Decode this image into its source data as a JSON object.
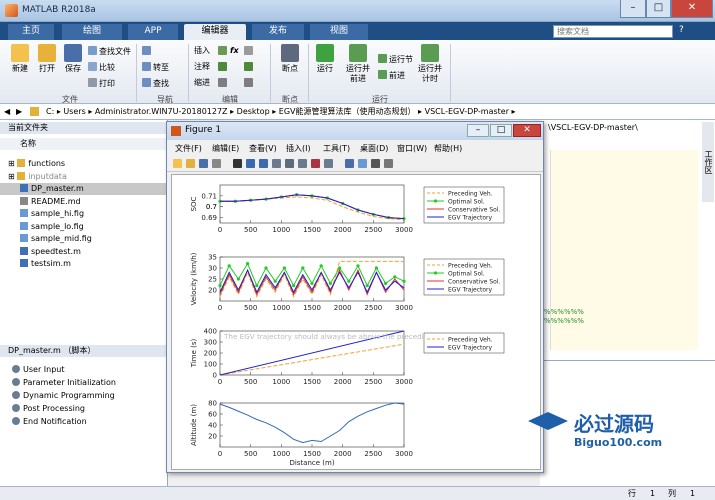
{
  "window": {
    "title": "MATLAB R2018a",
    "min": "–",
    "max": "□",
    "close": "✕"
  },
  "tabs": [
    {
      "label": "主页"
    },
    {
      "label": "绘图"
    },
    {
      "label": "APP"
    },
    {
      "label": "编辑器"
    },
    {
      "label": "发布"
    },
    {
      "label": "视图"
    }
  ],
  "search_placeholder": "搜索文档",
  "ribbon": {
    "new": "新建",
    "open": "打开",
    "save": "保存",
    "find_file": "查找文件",
    "compare": "比较",
    "print": "打印",
    "group_file": "文件",
    "goto": "转至",
    "find": "查找",
    "group_nav": "导航",
    "insert": "插入",
    "comment": "注释",
    "indent": "缩进",
    "group_edit": "编辑",
    "breakpoint": "断点",
    "group_bp": "断点",
    "run": "运行",
    "run_advance": "运行并\n前进",
    "run_section": "运行节",
    "advance": "前进",
    "run_time": "运行并\n计时",
    "group_run": "运行",
    "fx": "fx"
  },
  "addr": {
    "path": [
      "C:",
      "Users",
      "Administrator.WIN7U-20180127Z",
      "Desktop",
      "EGV能源管理算法库（使用动态规划）",
      "VSCL-EGV-DP-master"
    ]
  },
  "left": {
    "current_folder": "当前文件夹",
    "col_name": "名称",
    "files": [
      {
        "name": "functions",
        "type": "folder"
      },
      {
        "name": "inputdata",
        "type": "folder"
      },
      {
        "name": "DP_master.m",
        "type": "m"
      },
      {
        "name": "README.md",
        "type": "md"
      },
      {
        "name": "sample_hi.fig",
        "type": "fig"
      },
      {
        "name": "sample_lo.fig",
        "type": "fig"
      },
      {
        "name": "sample_mid.fig",
        "type": "fig"
      },
      {
        "name": "speedtest.m",
        "type": "m"
      },
      {
        "name": "testsim.m",
        "type": "m"
      }
    ],
    "details_title": "DP_master.m （脚本）",
    "outline": [
      "User Input",
      "Parameter Initialization",
      "Dynamic Programming",
      "Post Processing",
      "End Notification"
    ]
  },
  "right": {
    "path_tail": "）\\VSCL-EGV-DP-master\\",
    "side_tab": "工作区"
  },
  "status": {
    "line_label": "行",
    "line": "1",
    "col_label": "列",
    "col": "1"
  },
  "figure": {
    "title": "Figure 1",
    "menu": [
      "文件(F)",
      "编辑(E)",
      "查看(V)",
      "插入(I)",
      "工具(T)",
      "桌面(D)",
      "窗口(W)",
      "帮助(H)"
    ]
  },
  "watermark": {
    "text": "必过源码",
    "url": "Biguo100.com"
  },
  "chart_data": [
    {
      "type": "line",
      "ylabel": "SOC",
      "xlim": [
        0,
        3000
      ],
      "ylim": [
        0.685,
        0.72
      ],
      "yticks": [
        0.69,
        0.7,
        0.71,
        "0.7"
      ],
      "legend": [
        "Preceding Veh.",
        "Optimal Sol.",
        "Conservative Sol.",
        "EGV Trajectory"
      ],
      "x": [
        0,
        250,
        500,
        750,
        1000,
        1250,
        1500,
        1750,
        2000,
        2250,
        2500,
        2750,
        3000
      ],
      "series": [
        {
          "name": "Preceding Veh.",
          "values": [
            0.705,
            0.705,
            0.706,
            0.707,
            0.708,
            0.709,
            0.708,
            0.706,
            0.7,
            0.695,
            0.691,
            0.689,
            0.688
          ]
        },
        {
          "name": "Optimal Sol.",
          "values": [
            0.705,
            0.705,
            0.706,
            0.707,
            0.709,
            0.711,
            0.71,
            0.708,
            0.703,
            0.697,
            0.693,
            0.69,
            0.689
          ]
        },
        {
          "name": "Conservative Sol.",
          "values": [
            0.705,
            0.705,
            0.706,
            0.707,
            0.709,
            0.711,
            0.71,
            0.708,
            0.703,
            0.697,
            0.693,
            0.69,
            0.689
          ]
        },
        {
          "name": "EGV Trajectory",
          "values": [
            0.705,
            0.705,
            0.706,
            0.707,
            0.709,
            0.711,
            0.71,
            0.708,
            0.703,
            0.697,
            0.693,
            0.69,
            0.689
          ]
        }
      ]
    },
    {
      "type": "line",
      "ylabel": "Velocity (km/h)",
      "xlim": [
        0,
        3000
      ],
      "ylim": [
        15,
        35
      ],
      "yticks": [
        20,
        25,
        30,
        35
      ],
      "legend": [
        "Preceding Veh.",
        "Optimal Sol.",
        "Conservative Sol.",
        "EGV Trajectory"
      ],
      "x": [
        0,
        150,
        300,
        450,
        600,
        750,
        900,
        1050,
        1200,
        1350,
        1500,
        1650,
        1800,
        1950,
        2100,
        2250,
        2400,
        2550,
        2700,
        2850,
        3000
      ],
      "series": [
        {
          "name": "Preceding Veh.",
          "values": [
            17,
            26,
            18,
            28,
            17,
            25,
            19,
            27,
            17,
            25,
            18,
            27,
            18,
            33,
            33,
            33,
            33,
            33,
            33,
            33,
            33
          ]
        },
        {
          "name": "Optimal Sol.",
          "values": [
            22,
            31,
            25,
            32,
            22,
            30,
            24,
            30,
            22,
            30,
            23,
            31,
            23,
            30,
            24,
            31,
            22,
            30,
            23,
            26,
            24
          ]
        },
        {
          "name": "Conservative Sol.",
          "values": [
            18,
            27,
            19,
            29,
            18,
            26,
            20,
            28,
            18,
            26,
            19,
            28,
            19,
            29,
            20,
            29,
            18,
            28,
            19,
            25,
            20
          ]
        },
        {
          "name": "EGV Trajectory",
          "values": [
            19,
            28,
            20,
            29,
            19,
            27,
            21,
            28,
            19,
            27,
            20,
            28,
            20,
            28,
            21,
            28,
            19,
            28,
            20,
            24,
            21
          ]
        }
      ]
    },
    {
      "type": "line",
      "ylabel": "Time (s)",
      "xlim": [
        0,
        3000
      ],
      "ylim": [
        0,
        400
      ],
      "yticks": [
        0,
        100,
        200,
        300,
        400
      ],
      "annotation": "The EGV trajectory should always be above the preceding vehicle",
      "legend": [
        "Preceding Veh.",
        "EGV Trajectory"
      ],
      "x": [
        0,
        3000
      ],
      "series": [
        {
          "name": "Preceding Veh.",
          "values": [
            0,
            280
          ]
        },
        {
          "name": "EGV Trajectory",
          "values": [
            0,
            400
          ]
        }
      ]
    },
    {
      "type": "line",
      "ylabel": "Altitude (m)",
      "xlabel": "Distance (m)",
      "xlim": [
        0,
        3000
      ],
      "ylim": [
        0,
        80
      ],
      "yticks": [
        20,
        40,
        60,
        80
      ],
      "xticks": [
        0,
        500,
        1000,
        1500,
        2000,
        2500,
        3000
      ],
      "x": [
        0,
        150,
        300,
        450,
        600,
        750,
        900,
        1050,
        1200,
        1350,
        1500,
        1650,
        1800,
        1950,
        2100,
        2250,
        2400,
        2550,
        2700,
        2850,
        3000
      ],
      "series": [
        {
          "name": "",
          "values": [
            78,
            72,
            65,
            58,
            50,
            44,
            36,
            26,
            14,
            8,
            12,
            10,
            20,
            30,
            46,
            56,
            64,
            70,
            76,
            80,
            78
          ]
        }
      ]
    }
  ]
}
